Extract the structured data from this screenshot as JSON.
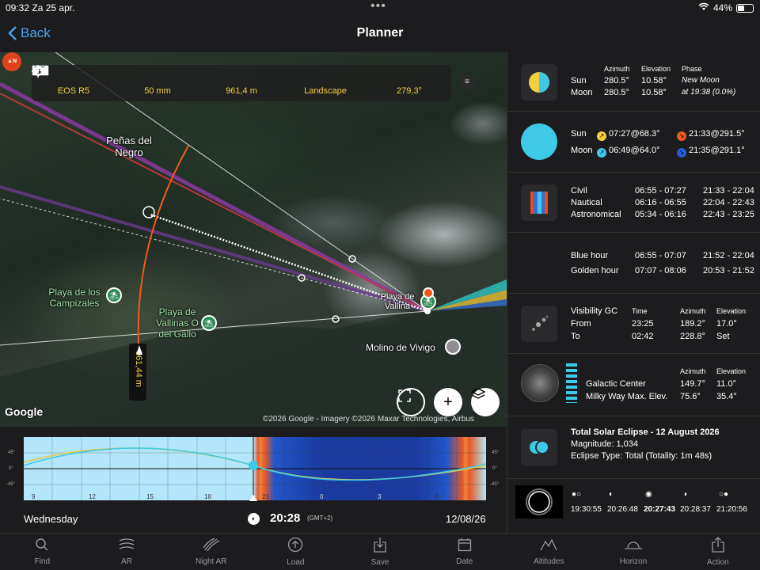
{
  "status_bar": {
    "time": "09:32",
    "date": "Za 25 apr.",
    "battery": "44%",
    "battery_level": 0.44
  },
  "nav": {
    "back_label": "Back",
    "title": "Planner"
  },
  "map": {
    "compass_letter": "N",
    "toolbar": [
      {
        "icon": "camera-icon",
        "label": "EOS R5"
      },
      {
        "icon": "lens-icon",
        "label": "50 mm"
      },
      {
        "icon": "distance-icon",
        "label": "961,4 m"
      },
      {
        "icon": "frame-icon",
        "label": "Landscape"
      },
      {
        "icon": "target-icon",
        "label": "279,3°"
      }
    ],
    "labels": {
      "penas": "Peñas del Negro",
      "campizales": "Playa de los Campizales",
      "vallinas": "Playa de Vallinas O del Gallo",
      "playa_vallina": "Playa de Vallina",
      "molino": "Molino de Vivigo"
    },
    "distance_label": "961,44 m",
    "google": "Google",
    "copyright": "©2026 Google - Imagery ©2026 Maxar Technologies, Airbus"
  },
  "timeline": {
    "y_ticks": [
      "45°",
      "0°",
      "-45°"
    ],
    "x_ticks": [
      "9",
      "12",
      "15",
      "18",
      "21",
      "0",
      "3",
      "6"
    ],
    "weekday": "Wednesday",
    "time": "20:28",
    "tz": "(GMT+2)",
    "date": "12/08/26"
  },
  "panel": {
    "position": {
      "headers": [
        "Azimuth",
        "Elevation",
        "Phase"
      ],
      "sun": {
        "label": "Sun",
        "azimuth": "280.5°",
        "elevation": "10.58°",
        "phase": "New Moon"
      },
      "moon": {
        "label": "Moon",
        "azimuth": "280.5°",
        "elevation": "10.58°",
        "phase": "at 19:38 (0.0%)"
      }
    },
    "rise_set": {
      "sun": {
        "label": "Sun",
        "rise": "07:27@68.3°",
        "set": "21:33@291.5°"
      },
      "moon": {
        "label": "Moon",
        "rise": "06:49@64.0°",
        "set": "21:35@291.1°"
      }
    },
    "twilight": [
      {
        "label": "Civil",
        "morning": "06:55 - 07:27",
        "evening": "21:33 - 22:04"
      },
      {
        "label": "Nautical",
        "morning": "06:16 - 06:55",
        "evening": "22:04 - 22:43"
      },
      {
        "label": "Astronomical",
        "morning": "05:34 - 06:16",
        "evening": "22:43 - 23:25"
      }
    ],
    "hours": [
      {
        "label": "Blue hour",
        "morning": "06:55 - 07:07",
        "evening": "21:52 - 22:04"
      },
      {
        "label": "Golden hour",
        "morning": "07:07 - 08:06",
        "evening": "20:53 - 21:52"
      }
    ],
    "visibility": {
      "title": "Visibility GC",
      "headers": [
        "Time",
        "Azimuth",
        "Elevation"
      ],
      "from": {
        "label": "From",
        "time": "23:25",
        "azimuth": "189.2°",
        "elevation": "17.0°"
      },
      "to": {
        "label": "To",
        "time": "02:42",
        "azimuth": "228.8°",
        "elevation": "Set"
      }
    },
    "galactic": {
      "headers": [
        "Azimuth",
        "Elevation"
      ],
      "center": {
        "label": "Galactic Center",
        "azimuth": "149.7°",
        "elevation": "11.0°"
      },
      "max": {
        "label": "Milky Way Max. Elev.",
        "azimuth": "75.6°",
        "elevation": "35.4°"
      }
    },
    "eclipse": {
      "title": "Total Solar Eclipse - 12 August 2026",
      "magnitude": "Magnitude: 1,034",
      "type": "Eclipse Type: Total (Totality: 1m 48s)"
    },
    "contacts": [
      "19:30:55",
      "20:26:48",
      "20:27:43",
      "20:28:37",
      "21:20:56"
    ]
  },
  "tabs": [
    "Find",
    "AR",
    "Night AR",
    "Load",
    "Save",
    "Date",
    "Altitudes",
    "Horizon",
    "Action"
  ],
  "colors": {
    "accent": "#4aa3f0",
    "sun": "#f4d03f",
    "moon": "#3ec9e6",
    "sunset": "#f05a1c",
    "moonset": "#2a5bd7"
  }
}
